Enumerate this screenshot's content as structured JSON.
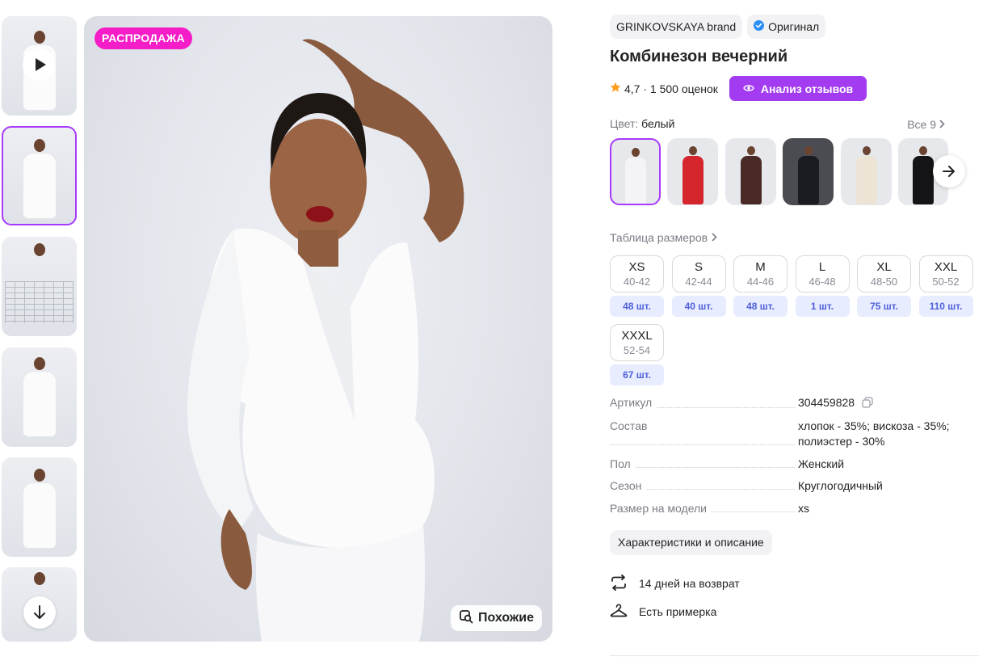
{
  "gallery": {
    "thumbnails": [
      {
        "kind": "video"
      },
      {
        "kind": "photo",
        "active": true
      },
      {
        "kind": "size-chart"
      },
      {
        "kind": "photo"
      },
      {
        "kind": "photo"
      },
      {
        "kind": "photo"
      }
    ],
    "sale_badge": "РАСПРОДАЖА",
    "similar_label": "Похожие"
  },
  "product": {
    "brand": "GRINKOVSKAYA brand",
    "original_label": "Оригинал",
    "title": "Комбинезон вечерний",
    "rating": "4,7 · 1 500 оценок",
    "review_analysis_label": "Анализ отзывов",
    "color_label": "Цвет:",
    "color_value": "белый",
    "all_colors_label": "Все 9",
    "swatches": [
      {
        "color": "#f4f4f6",
        "active": true
      },
      {
        "color": "#d6262d"
      },
      {
        "color": "#4a2a26"
      },
      {
        "color": "#1b1b22"
      },
      {
        "color": "#ece5d6"
      },
      {
        "color": "#141416"
      }
    ],
    "size_table_label": "Таблица размеров",
    "sizes": [
      {
        "name": "XS",
        "ru": "40-42",
        "stock": "48 шт."
      },
      {
        "name": "S",
        "ru": "42-44",
        "stock": "40 шт."
      },
      {
        "name": "M",
        "ru": "44-46",
        "stock": "48 шт."
      },
      {
        "name": "L",
        "ru": "46-48",
        "stock": "1 шт."
      },
      {
        "name": "XL",
        "ru": "48-50",
        "stock": "75 шт."
      },
      {
        "name": "XXL",
        "ru": "50-52",
        "stock": "110 шт."
      },
      {
        "name": "XXXL",
        "ru": "52-54",
        "stock": "67 шт."
      }
    ],
    "specs": [
      {
        "label": "Артикул",
        "value": "304459828"
      },
      {
        "label": "Состав",
        "value": "хлопок - 35%; вискоза - 35%; полиэстер - 30%"
      },
      {
        "label": "Пол",
        "value": "Женский"
      },
      {
        "label": "Сезон",
        "value": "Круглогодичный"
      },
      {
        "label": "Размер на модели",
        "value": "xs"
      }
    ],
    "description_button": "Характеристики и описание",
    "features": [
      {
        "icon": "return-arrows-icon",
        "text": "14 дней на возврат"
      },
      {
        "icon": "hanger-icon",
        "text": "Есть примерка"
      }
    ]
  },
  "colors": {
    "accent": "#a73afd",
    "sale": "#f41dc7",
    "review_button": "#a33cf0",
    "stock_bg": "#e7ecff",
    "stock_text": "#4e5fd9"
  }
}
